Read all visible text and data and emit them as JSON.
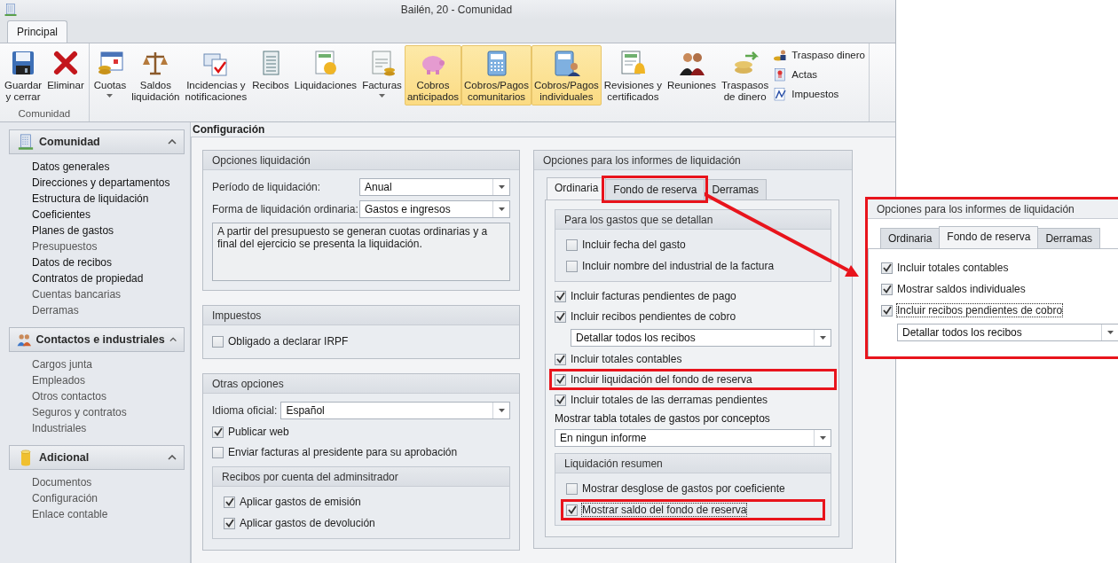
{
  "window": {
    "title": "Bailén, 20 - Comunidad"
  },
  "ribbon": {
    "tabs": [
      {
        "label": "Principal",
        "selected": true
      }
    ],
    "groups": [
      {
        "label": "Comunidad",
        "buttons": [
          {
            "label": "Guardar\ny cerrar",
            "dropdown": false,
            "highlighted": false
          },
          {
            "label": "Eliminar",
            "dropdown": false,
            "highlighted": false
          }
        ]
      },
      {
        "buttons": [
          {
            "label": "Cuotas",
            "dropdown": true,
            "highlighted": false
          },
          {
            "label": "Saldos\nliquidación",
            "dropdown": false,
            "highlighted": false
          },
          {
            "label": "Incidencias y\nnotificaciones",
            "dropdown": false,
            "highlighted": false
          },
          {
            "label": "Recibos",
            "dropdown": false,
            "highlighted": false
          },
          {
            "label": "Liquidaciones",
            "dropdown": false,
            "highlighted": false
          },
          {
            "label": "Facturas",
            "dropdown": true,
            "highlighted": false
          },
          {
            "label": "Cobros\nanticipados",
            "dropdown": false,
            "highlighted": true
          },
          {
            "label": "Cobros/Pagos\ncomunitarios",
            "dropdown": false,
            "highlighted": true
          },
          {
            "label": "Cobros/Pagos\nindividuales",
            "dropdown": false,
            "highlighted": true
          },
          {
            "label": "Revisiones y\ncertificados",
            "dropdown": false,
            "highlighted": false
          },
          {
            "label": "Reuniones",
            "dropdown": false,
            "highlighted": false
          },
          {
            "label": "Traspasos\nde dinero",
            "dropdown": false,
            "highlighted": false
          }
        ],
        "small_buttons": [
          {
            "label": "Traspaso dinero"
          },
          {
            "label": "Actas"
          },
          {
            "label": "Impuestos"
          }
        ]
      }
    ]
  },
  "sidebar": {
    "sections": [
      {
        "title": "Comunidad",
        "expanded": true,
        "items": [
          {
            "label": "Datos generales",
            "dimmed": false
          },
          {
            "label": "Direcciones y departamentos",
            "dimmed": false
          },
          {
            "label": "Estructura de liquidación",
            "dimmed": false
          },
          {
            "label": "Coeficientes",
            "dimmed": false
          },
          {
            "label": "Planes de gastos",
            "dimmed": false
          },
          {
            "label": "Presupuestos",
            "dimmed": true
          },
          {
            "label": "Datos de recibos",
            "dimmed": false
          },
          {
            "label": "Contratos de propiedad",
            "dimmed": false
          },
          {
            "label": "Cuentas bancarias",
            "dimmed": true
          },
          {
            "label": "Derramas",
            "dimmed": true
          }
        ]
      },
      {
        "title": "Contactos e industriales",
        "expanded": true,
        "items": [
          {
            "label": "Cargos junta",
            "dimmed": true
          },
          {
            "label": "Empleados",
            "dimmed": true
          },
          {
            "label": "Otros contactos",
            "dimmed": true
          },
          {
            "label": "Seguros y contratos",
            "dimmed": true
          },
          {
            "label": "Industriales",
            "dimmed": true
          }
        ]
      },
      {
        "title": "Adicional",
        "expanded": true,
        "items": [
          {
            "label": "Documentos",
            "dimmed": true
          },
          {
            "label": "Configuración",
            "dimmed": true
          },
          {
            "label": "Enlace contable",
            "dimmed": true
          }
        ]
      }
    ]
  },
  "content": {
    "title": "Configuración",
    "left_panels": [
      {
        "title": "Opciones liquidación",
        "items": [
          {
            "kind": "field",
            "label": "Período de liquidación:",
            "value": "Anual"
          },
          {
            "kind": "field",
            "label": "Forma de liquidación ordinaria:",
            "value": "Gastos e ingresos"
          },
          {
            "kind": "memo",
            "text": "A partir del presupuesto se generan cuotas ordinarias y a final del ejercicio se presenta la liquidación."
          }
        ]
      },
      {
        "title": "Impuestos",
        "items": [
          {
            "kind": "checkbox",
            "label": "Obligado a declarar IRPF",
            "checked": false,
            "focused": false,
            "annotated": false
          }
        ]
      },
      {
        "title": "Otras opciones",
        "items": [
          {
            "kind": "field",
            "label": "Idioma oficial:",
            "value": "Español"
          },
          {
            "kind": "checkbox",
            "label": "Publicar web",
            "checked": true,
            "focused": false,
            "annotated": false
          },
          {
            "kind": "checkbox",
            "label": "Enviar facturas al presidente para su aprobación",
            "checked": false,
            "focused": false,
            "annotated": false
          },
          {
            "kind": "group",
            "title": "Recibos por cuenta del adminsitrador",
            "items": [
              {
                "kind": "checkbox",
                "label": "Aplicar gastos de emisión",
                "checked": true,
                "focused": false,
                "annotated": false
              },
              {
                "kind": "checkbox",
                "label": "Aplicar gastos de devolución",
                "checked": true,
                "focused": false,
                "annotated": false
              }
            ]
          }
        ]
      }
    ],
    "right_panel": {
      "title": "Opciones para los informes de liquidación",
      "tabs": [
        {
          "label": "Ordinaria",
          "selected": true,
          "annotated": false
        },
        {
          "label": "Fondo de reserva",
          "selected": false,
          "annotated": true
        },
        {
          "label": "Derramas",
          "selected": false,
          "annotated": false
        }
      ],
      "items": [
        {
          "kind": "group",
          "title": "Para los gastos que se detallan",
          "items": [
            {
              "kind": "checkbox",
              "label": "Incluir fecha del gasto",
              "checked": false,
              "focused": false,
              "annotated": false
            },
            {
              "kind": "checkbox",
              "label": "Incluir nombre del industrial de la factura",
              "checked": false,
              "focused": false,
              "annotated": false
            }
          ]
        },
        {
          "kind": "checkbox",
          "label": "Incluir facturas pendientes de pago",
          "checked": true,
          "focused": false,
          "annotated": false
        },
        {
          "kind": "checkbox",
          "label": "Incluir recibos pendientes de cobro",
          "checked": true,
          "focused": false,
          "annotated": false,
          "dropdown": "Detallar todos los recibos"
        },
        {
          "kind": "checkbox",
          "label": "Incluir totales contables",
          "checked": true,
          "focused": false,
          "annotated": false
        },
        {
          "kind": "checkbox",
          "label": "Incluir liquidación del fondo de reserva",
          "checked": true,
          "focused": false,
          "annotated": true
        },
        {
          "kind": "checkbox",
          "label": "Incluir totales de las derramas pendientes",
          "checked": true,
          "focused": false,
          "annotated": false
        },
        {
          "kind": "caption",
          "text": "Mostrar tabla totales de gastos por conceptos"
        },
        {
          "kind": "dropdown",
          "value": "En ningun informe"
        },
        {
          "kind": "group",
          "title": "Liquidación resumen",
          "items": [
            {
              "kind": "checkbox",
              "label": "Mostrar desglose de gastos por coeficiente",
              "checked": false,
              "focused": false,
              "annotated": false
            },
            {
              "kind": "checkbox",
              "label": "Mostrar saldo del fondo de reserva",
              "checked": true,
              "focused": true,
              "annotated": true
            }
          ]
        }
      ]
    }
  },
  "callout": {
    "annotated": true,
    "title": "Opciones para los informes de liquidación",
    "tabs": [
      {
        "label": "Ordinaria",
        "selected": false,
        "annotated": false
      },
      {
        "label": "Fondo de reserva",
        "selected": true,
        "annotated": false
      },
      {
        "label": "Derramas",
        "selected": false,
        "annotated": false
      }
    ],
    "items": [
      {
        "kind": "checkbox",
        "label": "Incluir totales contables",
        "checked": true,
        "focused": false,
        "annotated": false
      },
      {
        "kind": "checkbox",
        "label": "Mostrar saldos individuales",
        "checked": true,
        "focused": false,
        "annotated": false
      },
      {
        "kind": "checkbox",
        "label": "Incluir recibos pendientes de cobro",
        "checked": true,
        "focused": true,
        "annotated": false,
        "dropdown": "Detallar todos los recibos"
      }
    ]
  }
}
